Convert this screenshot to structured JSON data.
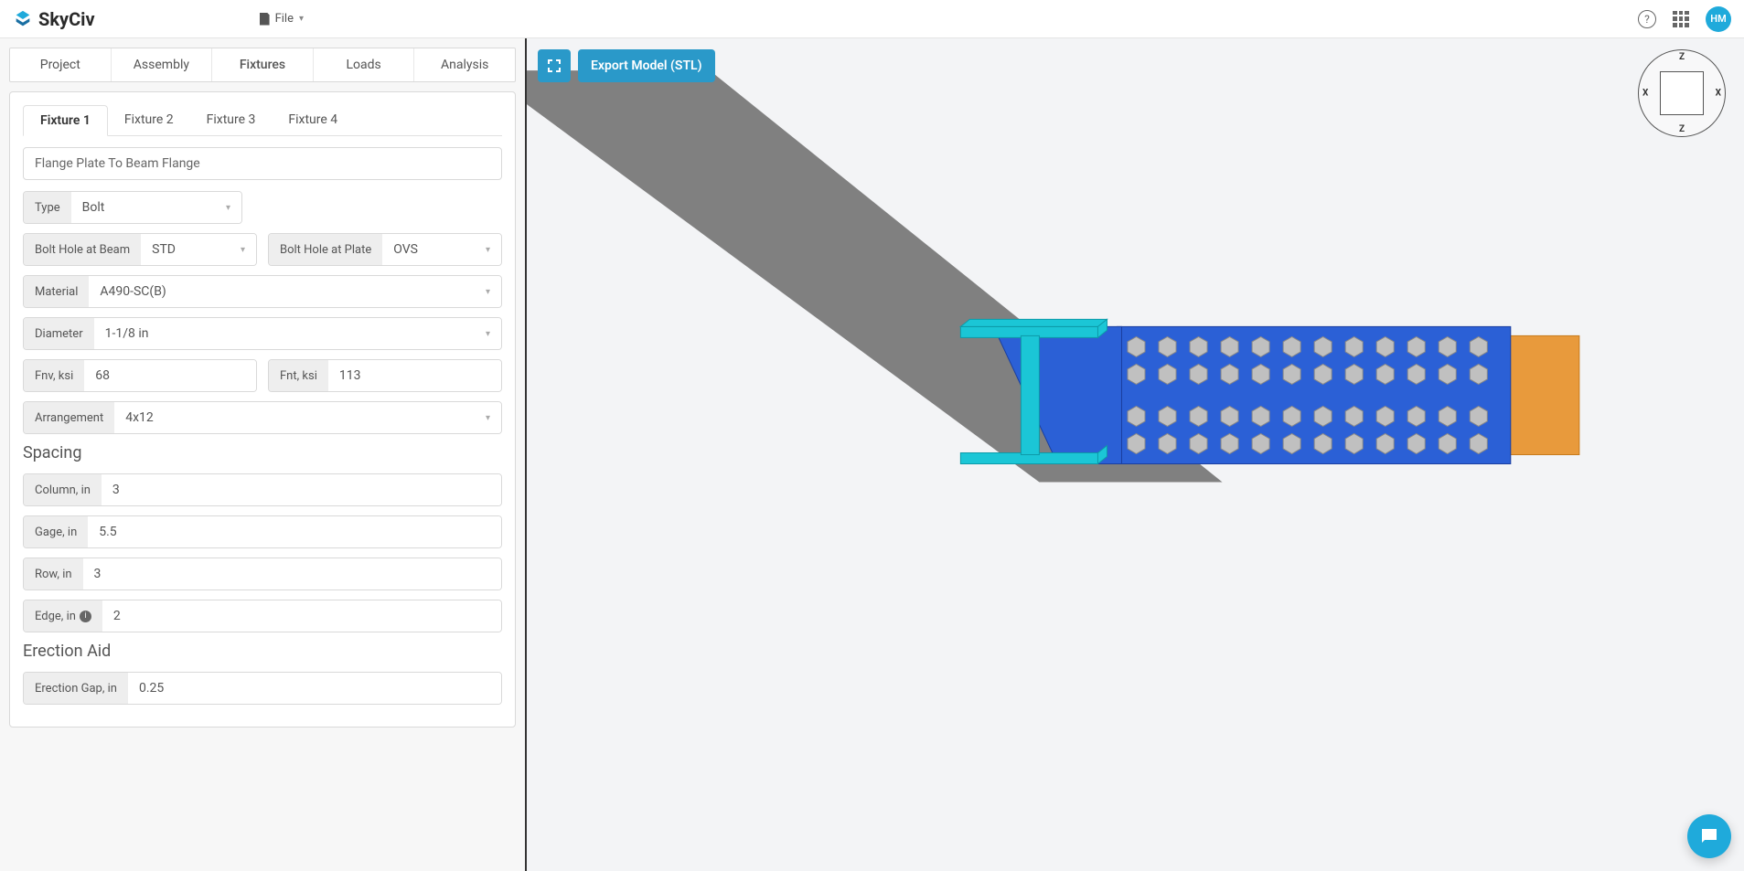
{
  "brand": "SkyCiv",
  "file_menu_label": "File",
  "avatar_initials": "HM",
  "main_tabs": [
    {
      "label": "Project",
      "active": false
    },
    {
      "label": "Assembly",
      "active": false
    },
    {
      "label": "Fixtures",
      "active": true
    },
    {
      "label": "Loads",
      "active": false
    },
    {
      "label": "Analysis",
      "active": false
    }
  ],
  "fixture_tabs": [
    {
      "label": "Fixture 1",
      "active": true
    },
    {
      "label": "Fixture 2",
      "active": false
    },
    {
      "label": "Fixture 3",
      "active": false
    },
    {
      "label": "Fixture 4",
      "active": false
    }
  ],
  "fixture_name": "Flange Plate To Beam Flange",
  "type": {
    "label": "Type",
    "value": "Bolt"
  },
  "bolt_hole_beam": {
    "label": "Bolt Hole at Beam",
    "value": "STD"
  },
  "bolt_hole_plate": {
    "label": "Bolt Hole at Plate",
    "value": "OVS"
  },
  "material": {
    "label": "Material",
    "value": "A490-SC(B)"
  },
  "diameter": {
    "label": "Diameter",
    "value": "1-1/8 in"
  },
  "fnv": {
    "label": "Fnv, ksi",
    "value": "68"
  },
  "fnt": {
    "label": "Fnt, ksi",
    "value": "113"
  },
  "arrangement": {
    "label": "Arrangement",
    "value": "4x12"
  },
  "spacing_heading": "Spacing",
  "column": {
    "label": "Column, in",
    "value": "3"
  },
  "gage": {
    "label": "Gage, in",
    "value": "5.5"
  },
  "row": {
    "label": "Row, in",
    "value": "3"
  },
  "edge": {
    "label": "Edge, in",
    "value": "2"
  },
  "erection_heading": "Erection Aid",
  "erection_gap": {
    "label": "Erection Gap, in",
    "value": "0.25"
  },
  "export_button": "Export Model (STL)",
  "navball": {
    "top": "Z",
    "bottom": "Z",
    "left": "X",
    "right": "X"
  },
  "colors": {
    "accent": "#2a99c9",
    "plate": "#2b60d6",
    "column": "#1bc6d6",
    "beam": "#e89a3c",
    "bolt": "#c0c0c0",
    "shadow": "#808080"
  }
}
